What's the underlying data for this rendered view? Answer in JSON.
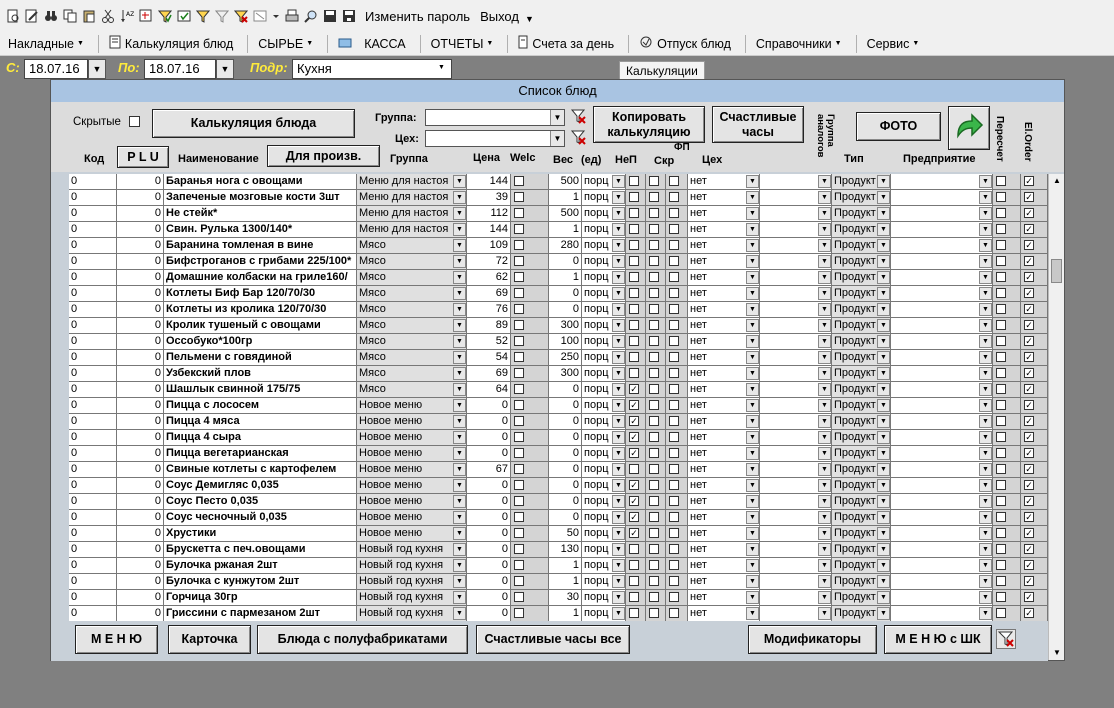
{
  "toolbar": {
    "change_password": "Изменить пароль",
    "exit": "Выход"
  },
  "menu": {
    "items": [
      "Накладные",
      "Калькуляция блюд",
      "СЫРЬЕ",
      "КАССА",
      "ОТЧЕТЫ",
      "Счета за день",
      "Отпуск блюд",
      "Справочники",
      "Сервис"
    ]
  },
  "filter": {
    "from_label": "С:",
    "from_value": "18.07.16",
    "to_label": "По:",
    "to_value": "18.07.16",
    "dept_label": "Подр:",
    "dept_value": "Кухня"
  },
  "tooltip": "Калькуляции",
  "window": {
    "title": "Список блюд",
    "hidden_label": "Скрытые",
    "calc_button": "Калькуляция блюда",
    "group_label": "Группа:",
    "shop_label": "Цех:",
    "copy_button": "Копировать калькуляцию",
    "happy_hours_button": "Счастливые часы",
    "photo_button": "ФОТО",
    "plu_button": "P L U",
    "for_prod_button": "Для произв.",
    "columns": {
      "code": "Код",
      "name": "Наименование",
      "group": "Группа",
      "price": "Цена",
      "welc": "Welc",
      "weight": "Вес",
      "unit": "(ед)",
      "nep": "НеП",
      "fp": "ФП",
      "skr": "Скр",
      "shop": "Цех",
      "analog_group": "Группа аналогов",
      "type": "Тип",
      "enterprise": "Предприятие",
      "recount": "Пересчет",
      "elorder": "El.Order"
    }
  },
  "rows": [
    {
      "code": "0",
      "plu": "0",
      "name": "Баранья нога с овощами",
      "group": "Меню для настоя",
      "price": "144",
      "weight": "500",
      "unit": "порц",
      "welc": false,
      "nep": false,
      "shop": "нет",
      "type": "Продукт",
      "el": true
    },
    {
      "code": "0",
      "plu": "0",
      "name": "Запеченые мозговые кости 3шт",
      "group": "Меню для настоя",
      "price": "39",
      "weight": "1",
      "unit": "порц",
      "welc": false,
      "nep": false,
      "shop": "нет",
      "type": "Продукт",
      "el": true
    },
    {
      "code": "0",
      "plu": "0",
      "name": "Не стейк*",
      "group": "Меню для настоя",
      "price": "112",
      "weight": "500",
      "unit": "порц",
      "welc": false,
      "nep": false,
      "shop": "нет",
      "type": "Продукт",
      "el": true
    },
    {
      "code": "0",
      "plu": "0",
      "name": "Свин. Рулька 1300/140*",
      "group": "Меню для настоя",
      "price": "144",
      "weight": "1",
      "unit": "порц",
      "welc": false,
      "nep": false,
      "shop": "нет",
      "type": "Продукт",
      "el": true
    },
    {
      "code": "0",
      "plu": "0",
      "name": "Баранина томленая в вине",
      "group": "Мясо",
      "price": "109",
      "weight": "280",
      "unit": "порц",
      "welc": false,
      "nep": false,
      "shop": "нет",
      "type": "Продукт",
      "el": true
    },
    {
      "code": "0",
      "plu": "0",
      "name": "Бифстроганов с грибами 225/100*",
      "group": "Мясо",
      "price": "72",
      "weight": "0",
      "unit": "порц",
      "welc": false,
      "nep": false,
      "shop": "нет",
      "type": "Продукт",
      "el": true
    },
    {
      "code": "0",
      "plu": "0",
      "name": "Домашние колбаски на гриле160/",
      "group": "Мясо",
      "price": "62",
      "weight": "1",
      "unit": "порц",
      "welc": false,
      "nep": false,
      "shop": "нет",
      "type": "Продукт",
      "el": true
    },
    {
      "code": "0",
      "plu": "0",
      "name": "Котлеты Биф Бар 120/70/30",
      "group": "Мясо",
      "price": "69",
      "weight": "0",
      "unit": "порц",
      "welc": false,
      "nep": false,
      "shop": "нет",
      "type": "Продукт",
      "el": true
    },
    {
      "code": "0",
      "plu": "0",
      "name": "Котлеты из кролика 120/70/30",
      "group": "Мясо",
      "price": "76",
      "weight": "0",
      "unit": "порц",
      "welc": false,
      "nep": false,
      "shop": "нет",
      "type": "Продукт",
      "el": true
    },
    {
      "code": "0",
      "plu": "0",
      "name": "Кролик тушеный с овощами",
      "group": "Мясо",
      "price": "89",
      "weight": "300",
      "unit": "порц",
      "welc": false,
      "nep": false,
      "shop": "нет",
      "type": "Продукт",
      "el": true
    },
    {
      "code": "0",
      "plu": "0",
      "name": "Оссобуко*100гр",
      "group": "Мясо",
      "price": "52",
      "weight": "100",
      "unit": "порц",
      "welc": false,
      "nep": false,
      "shop": "нет",
      "type": "Продукт",
      "el": true
    },
    {
      "code": "0",
      "plu": "0",
      "name": "Пельмени с  говядиной",
      "group": "Мясо",
      "price": "54",
      "weight": "250",
      "unit": "порц",
      "welc": false,
      "nep": false,
      "shop": "нет",
      "type": "Продукт",
      "el": true
    },
    {
      "code": "0",
      "plu": "0",
      "name": "Узбекский плов",
      "group": "Мясо",
      "price": "69",
      "weight": "300",
      "unit": "порц",
      "welc": false,
      "nep": false,
      "shop": "нет",
      "type": "Продукт",
      "el": true
    },
    {
      "code": "0",
      "plu": "0",
      "name": "Шашлык свинной 175/75",
      "group": "Мясо",
      "price": "64",
      "weight": "0",
      "unit": "порц",
      "welc": false,
      "nep": true,
      "shop": "нет",
      "type": "Продукт",
      "el": true
    },
    {
      "code": "0",
      "plu": "0",
      "name": "Пицца с лососем",
      "group": "Новое меню",
      "price": "0",
      "weight": "0",
      "unit": "порц",
      "welc": false,
      "nep": true,
      "shop": "нет",
      "type": "Продукт",
      "el": true
    },
    {
      "code": "0",
      "plu": "0",
      "name": "Пицца 4 мяса",
      "group": "Новое меню",
      "price": "0",
      "weight": "0",
      "unit": "порц",
      "welc": false,
      "nep": true,
      "shop": "нет",
      "type": "Продукт",
      "el": true
    },
    {
      "code": "0",
      "plu": "0",
      "name": "Пицца 4 сыра",
      "group": "Новое меню",
      "price": "0",
      "weight": "0",
      "unit": "порц",
      "welc": false,
      "nep": true,
      "shop": "нет",
      "type": "Продукт",
      "el": true
    },
    {
      "code": "0",
      "plu": "0",
      "name": "Пицца вегетарианская",
      "group": "Новое меню",
      "price": "0",
      "weight": "0",
      "unit": "порц",
      "welc": false,
      "nep": true,
      "shop": "нет",
      "type": "Продукт",
      "el": true
    },
    {
      "code": "0",
      "plu": "0",
      "name": "Свиные котлеты  с картофелем",
      "group": "Новое меню",
      "price": "67",
      "weight": "0",
      "unit": "порц",
      "welc": false,
      "nep": false,
      "shop": "нет",
      "type": "Продукт",
      "el": true
    },
    {
      "code": "0",
      "plu": "0",
      "name": "Соус Демигляс 0,035",
      "group": "Новое меню",
      "price": "0",
      "weight": "0",
      "unit": "порц",
      "welc": false,
      "nep": true,
      "shop": "нет",
      "type": "Продукт",
      "el": true
    },
    {
      "code": "0",
      "plu": "0",
      "name": "Соус Песто 0,035",
      "group": "Новое меню",
      "price": "0",
      "weight": "0",
      "unit": "порц",
      "welc": false,
      "nep": true,
      "shop": "нет",
      "type": "Продукт",
      "el": true
    },
    {
      "code": "0",
      "plu": "0",
      "name": "Соус чесночный 0,035",
      "group": "Новое меню",
      "price": "0",
      "weight": "0",
      "unit": "порц",
      "welc": false,
      "nep": true,
      "shop": "нет",
      "type": "Продукт",
      "el": true
    },
    {
      "code": "0",
      "plu": "0",
      "name": "Хрустики",
      "group": "Новое меню",
      "price": "0",
      "weight": "50",
      "unit": "порц",
      "welc": false,
      "nep": true,
      "shop": "нет",
      "type": "Продукт",
      "el": true
    },
    {
      "code": "0",
      "plu": "0",
      "name": "Брускетта с печ.овощами",
      "group": "Новый год  кухня",
      "price": "0",
      "weight": "130",
      "unit": "порц",
      "welc": false,
      "nep": false,
      "shop": "нет",
      "type": "Продукт",
      "el": true
    },
    {
      "code": "0",
      "plu": "0",
      "name": "Булочка ржаная 2шт",
      "group": "Новый год  кухня",
      "price": "0",
      "weight": "1",
      "unit": "порц",
      "welc": false,
      "nep": false,
      "shop": "нет",
      "type": "Продукт",
      "el": true
    },
    {
      "code": "0",
      "plu": "0",
      "name": "Булочка с кунжутом 2шт",
      "group": "Новый год  кухня",
      "price": "0",
      "weight": "1",
      "unit": "порц",
      "welc": false,
      "nep": false,
      "shop": "нет",
      "type": "Продукт",
      "el": true
    },
    {
      "code": "0",
      "plu": "0",
      "name": "Горчица 30гр",
      "group": "Новый год  кухня",
      "price": "0",
      "weight": "30",
      "unit": "порц",
      "welc": false,
      "nep": false,
      "shop": "нет",
      "type": "Продукт",
      "el": true
    },
    {
      "code": "0",
      "plu": "0",
      "name": "Гриссини с пармезаном 2шт",
      "group": "Новый год  кухня",
      "price": "0",
      "weight": "1",
      "unit": "порц",
      "welc": false,
      "nep": false,
      "shop": "нет",
      "type": "Продукт",
      "el": true
    }
  ],
  "footer": {
    "menu": "М Е Н Ю",
    "card": "Карточка",
    "semi": "Блюда с полуфабрикатами",
    "happy_all": "Счастливые часы все",
    "modifiers": "Модификаторы",
    "menu_shk": "М Е Н Ю с ШК"
  }
}
